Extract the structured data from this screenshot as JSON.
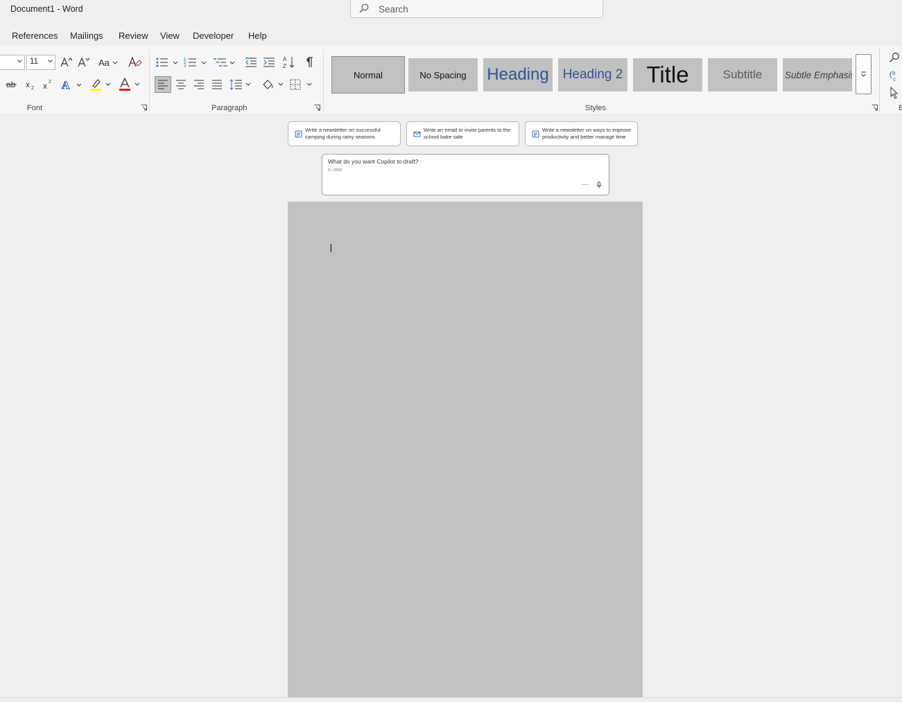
{
  "window": {
    "title": "Document1  -  Word"
  },
  "search": {
    "placeholder": "Search"
  },
  "menu": {
    "tabs": [
      "References",
      "Mailings",
      "Review",
      "View",
      "Developer",
      "Help"
    ]
  },
  "ribbon": {
    "font": {
      "group_label": "Font",
      "font_name_value": "",
      "font_size_value": "11"
    },
    "paragraph": {
      "group_label": "Paragraph"
    },
    "styles": {
      "group_label": "Styles",
      "items": [
        "Normal",
        "No Spacing",
        "Heading",
        "Heading 2",
        "Title",
        "Subtitle",
        "Subtle Emphasis"
      ],
      "selected": "Normal"
    },
    "colors": {
      "highlight": "#ffff00",
      "font_color": "#e81123",
      "heading_blue": "#2f5496"
    }
  },
  "copilot": {
    "suggestions": [
      "Write a newsletter on successful camping during rainy seasons",
      "Write an email to invite parents to the school bake sale",
      "Write a newsletter on ways to improve productivity and better manage time"
    ],
    "prompt_placeholder": "What do you want Copilot to draft?",
    "char_count": "0 / 2000",
    "more_label": "···"
  }
}
